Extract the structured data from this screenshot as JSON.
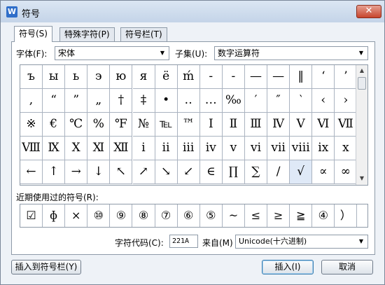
{
  "window": {
    "title": "符号",
    "app_icon": "W",
    "close_label": "✕"
  },
  "tabs": [
    {
      "label": "符号(S)",
      "active": true
    },
    {
      "label": "特殊字符(P)",
      "active": false
    },
    {
      "label": "符号栏(T)",
      "active": false
    }
  ],
  "font": {
    "label": "字体(F):",
    "value": "宋体"
  },
  "subset": {
    "label": "子集(U):",
    "value": "数字运算符"
  },
  "symbol_grid": {
    "rows": [
      [
        "ъ",
        "ы",
        "ь",
        "э",
        "ю",
        "я",
        "ё",
        "ḿ",
        "-",
        "-",
        "—",
        "—",
        "‖",
        "‘",
        "’"
      ],
      [
        ",",
        "“",
        "”",
        "„",
        "†",
        "‡",
        "•",
        "‥",
        "…",
        "‰",
        "′",
        "″",
        "‵",
        "‹",
        "›"
      ],
      [
        "※",
        "€",
        "℃",
        "%",
        "℉",
        "№",
        "℡",
        "™",
        "Ⅰ",
        "Ⅱ",
        "Ⅲ",
        "Ⅳ",
        "Ⅴ",
        "Ⅵ",
        "Ⅶ"
      ],
      [
        "Ⅷ",
        "Ⅸ",
        "Ⅹ",
        "Ⅺ",
        "Ⅻ",
        "ⅰ",
        "ⅱ",
        "ⅲ",
        "ⅳ",
        "ⅴ",
        "ⅵ",
        "ⅶ",
        "ⅷ",
        "ⅸ",
        "ⅹ"
      ],
      [
        "←",
        "↑",
        "→",
        "↓",
        "↖",
        "↗",
        "↘",
        "↙",
        "∈",
        "∏",
        "∑",
        "∕",
        "√",
        "∝",
        "∞"
      ]
    ],
    "selected": "√"
  },
  "recent": {
    "label": "近期使用过的符号(R):",
    "items": [
      "☑",
      "ɸ",
      "×",
      "⑩",
      "⑨",
      "⑧",
      "⑦",
      "⑥",
      "⑤",
      "~",
      "≤",
      "≥",
      "≧",
      "④",
      "）"
    ]
  },
  "char_code": {
    "label": "字符代码(C):",
    "value": "221A"
  },
  "from": {
    "label": "来自(M)",
    "value": "Unicode(十六进制)"
  },
  "buttons": {
    "insert_to_bar": "插入到符号栏(Y)",
    "insert": "插入(I)",
    "cancel": "取消"
  }
}
